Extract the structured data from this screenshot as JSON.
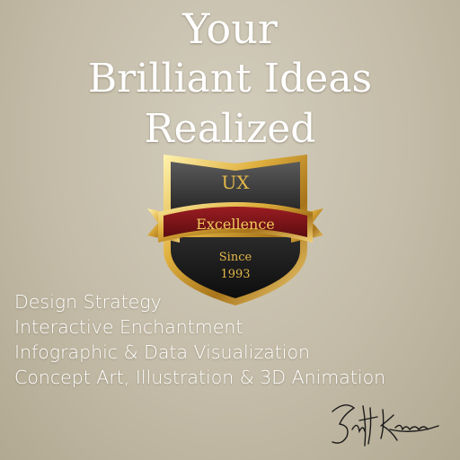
{
  "headline": {
    "line1": "Your",
    "line2": "Brilliant Ideas",
    "line3": "Realized"
  },
  "badge": {
    "top_text": "UX",
    "ribbon_text": "Excellence",
    "bottom_line1": "Since",
    "bottom_line2": "1993"
  },
  "services": [
    "Design Strategy",
    "Interactive Enchantment",
    "Infographic & Data Visualization",
    "Concept Art, Illustration & 3D Animation"
  ],
  "signature": {
    "text": "Scott Krause",
    "icon": "handwritten-signature"
  },
  "colors": {
    "gold": "#d9a72f",
    "ribbon": "#7a1418",
    "shield_dark": "#1f1f1f",
    "headline_text": "#ffffff"
  }
}
